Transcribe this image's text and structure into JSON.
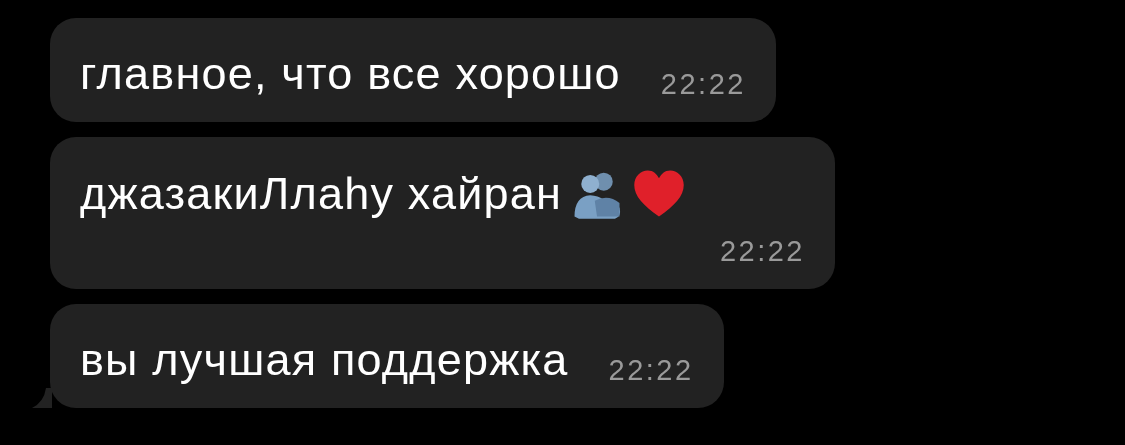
{
  "messages": [
    {
      "kind": "text",
      "text": "главное, что все хорошо",
      "time": "22:22",
      "tail": false
    },
    {
      "kind": "emoji_text",
      "text": "джазакиЛлаһу хайран",
      "time": "22:22",
      "tail": false
    },
    {
      "kind": "text",
      "text": "вы лучшая поддержка",
      "time": "22:22",
      "tail": true
    }
  ]
}
